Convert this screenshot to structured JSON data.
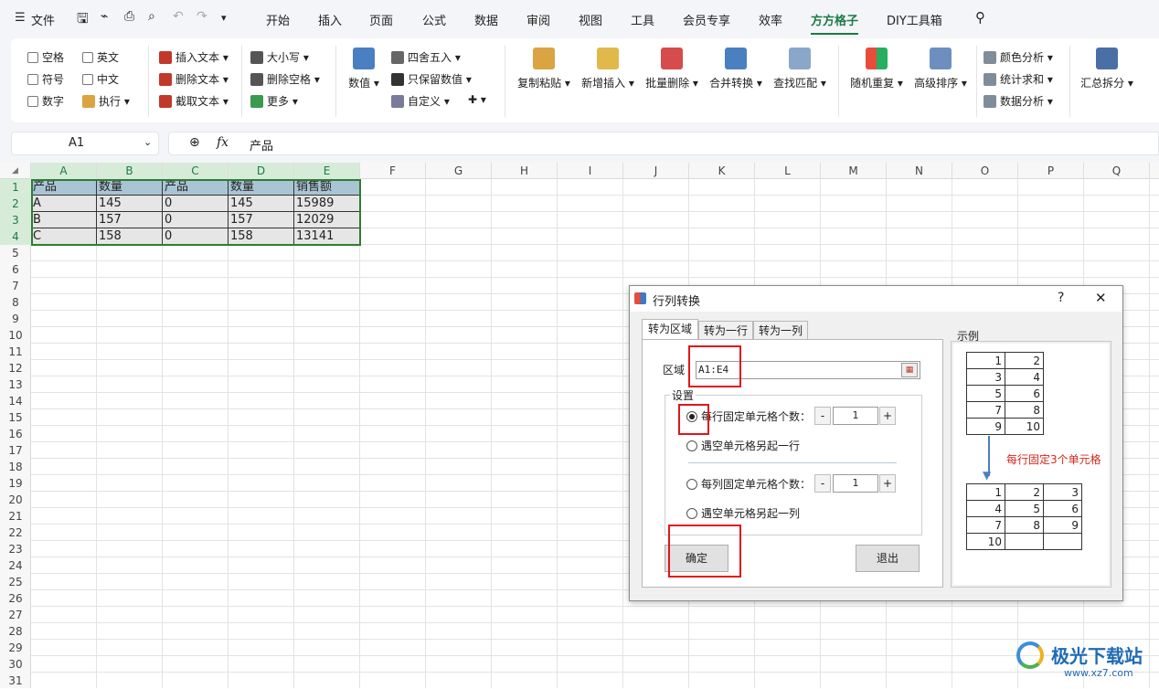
{
  "menubar": {
    "file": "文件",
    "tabs": [
      "开始",
      "插入",
      "页面",
      "公式",
      "数据",
      "审阅",
      "视图",
      "工具",
      "会员专享",
      "效率",
      "方方格子",
      "DIY工具箱"
    ],
    "active_tab": "方方格子"
  },
  "ribbon": {
    "checkboxes": [
      "空格",
      "英文",
      "符号",
      "中文",
      "数字"
    ],
    "exec": "执行",
    "text_ops": [
      "插入文本",
      "删除文本",
      "截取文本"
    ],
    "case_ops": [
      "大小写",
      "删除空格",
      "更多"
    ],
    "num_big": "数值",
    "num_ops": [
      "四舍五入",
      "只保留数值",
      "自定义"
    ],
    "big_buttons": [
      "复制粘贴",
      "新增插入",
      "批量删除",
      "合并转换",
      "查找匹配",
      "随机重复",
      "高级排序"
    ],
    "analysis": [
      "颜色分析",
      "统计求和",
      "数据分析"
    ],
    "summary": "汇总拆分"
  },
  "formula_bar": {
    "cell_ref": "A1",
    "fx": "fx",
    "content": "产品"
  },
  "columns": [
    "A",
    "B",
    "C",
    "D",
    "E",
    "F",
    "G",
    "H",
    "I",
    "J",
    "K",
    "L",
    "M",
    "N",
    "O",
    "P",
    "Q"
  ],
  "rows": [
    "1",
    "2",
    "3",
    "4",
    "5",
    "6",
    "7",
    "8",
    "9",
    "10",
    "11",
    "12",
    "13",
    "14",
    "15",
    "16",
    "17",
    "18",
    "19",
    "20",
    "21",
    "22",
    "23",
    "24",
    "25",
    "26",
    "27",
    "28",
    "29",
    "30",
    "31"
  ],
  "sheet": {
    "header": [
      "产品",
      "数量",
      "产品",
      "数量",
      "销售额"
    ],
    "data": [
      [
        "A",
        "145",
        "0",
        "145",
        "15989"
      ],
      [
        "B",
        "157",
        "0",
        "157",
        "12029"
      ],
      [
        "C",
        "158",
        "0",
        "158",
        "13141"
      ]
    ]
  },
  "dialog": {
    "title": "行列转换",
    "help": "?",
    "close": "✕",
    "tabs": [
      "转为区域",
      "转为一行",
      "转为一列"
    ],
    "range_label": "区域",
    "range_value": "A1:E4",
    "settings_label": "设置",
    "opt1": "每行固定单元格个数：",
    "opt1_value": "1",
    "opt2": "遇空单元格另起一行",
    "opt3": "每列固定单元格个数：",
    "opt3_value": "1",
    "opt4": "遇空单元格另起一列",
    "ok": "确定",
    "exit": "退出",
    "example_label": "示例",
    "example_top": [
      [
        "1",
        "2"
      ],
      [
        "3",
        "4"
      ],
      [
        "5",
        "6"
      ],
      [
        "7",
        "8"
      ],
      [
        "9",
        "10"
      ]
    ],
    "example_note": "每行固定3个单元格",
    "example_bottom": [
      [
        "1",
        "2",
        "3"
      ],
      [
        "4",
        "5",
        "6"
      ],
      [
        "7",
        "8",
        "9"
      ],
      [
        "10",
        "",
        ""
      ]
    ],
    "minus": "-",
    "plus": "+"
  },
  "watermark": {
    "name": "极光下载站",
    "url": "www.xz7.com"
  },
  "colors": {
    "accent": "#1d7a46",
    "red_box": "#e0161b",
    "note_red": "#d9261c"
  }
}
